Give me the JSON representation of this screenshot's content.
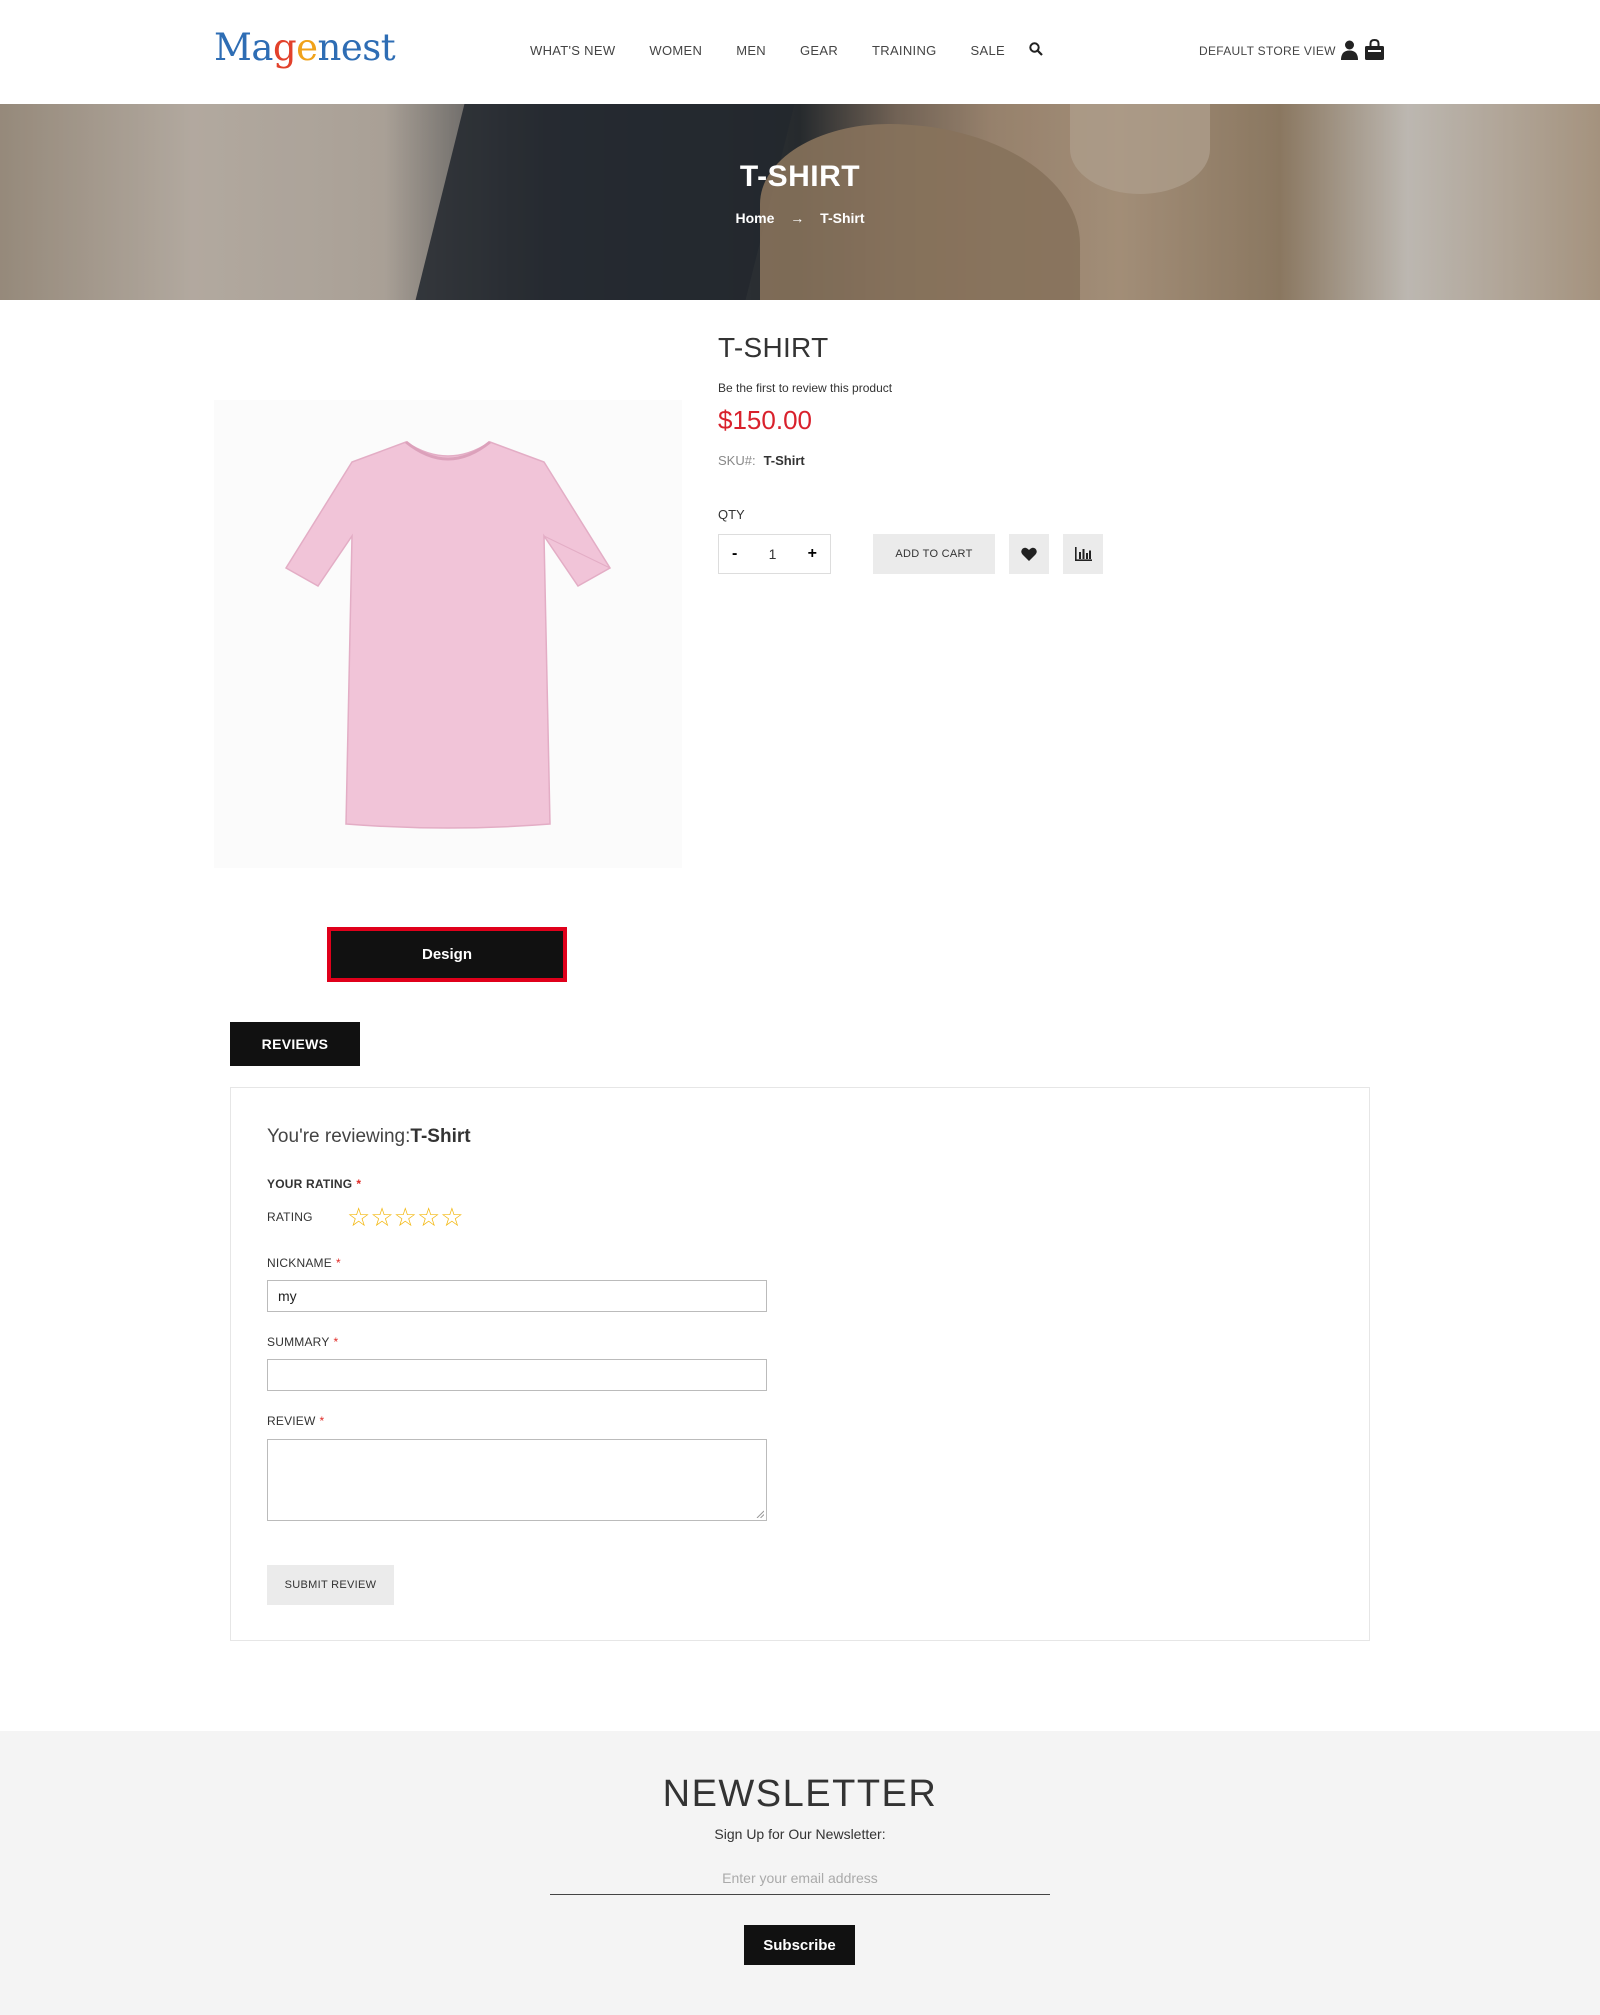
{
  "header": {
    "logo": {
      "p1": "Ma",
      "p2": "g",
      "p3": "e",
      "p4": "nest"
    },
    "nav": [
      "WHAT'S NEW",
      "WOMEN",
      "MEN",
      "GEAR",
      "TRAINING",
      "SALE"
    ],
    "store_view": "DEFAULT STORE VIEW",
    "icons": {
      "search": "search-icon",
      "user": "user-icon",
      "cart": "cart-icon"
    }
  },
  "hero": {
    "title": "T-SHIRT",
    "breadcrumb": {
      "home": "Home",
      "separator": "→",
      "current": "T-Shirt"
    }
  },
  "product": {
    "title": "T-SHIRT",
    "review_link": "Be the first to review this product",
    "price": "$150.00",
    "sku_label": "SKU#:",
    "sku_value": "T-Shirt",
    "qty_label": "QTY",
    "qty_minus": "-",
    "qty_value": "1",
    "qty_plus": "+",
    "add_to_cart": "ADD TO CART",
    "design_button": "Design",
    "image_color": "#f1c4d8"
  },
  "reviews": {
    "tab_label": "REVIEWS",
    "heading_prefix": "You're reviewing:",
    "heading_product": "T-Shirt",
    "your_rating": "YOUR RATING",
    "rating_label": "RATING",
    "stars": [
      "☆",
      "☆",
      "☆",
      "☆",
      "☆"
    ],
    "nickname_label": "NICKNAME",
    "nickname_value": "my",
    "summary_label": "SUMMARY",
    "summary_value": "",
    "review_label": "REVIEW",
    "required_mark": "*",
    "submit": "SUBMIT REVIEW"
  },
  "newsletter": {
    "title": "NEWSLETTER",
    "subtitle": "Sign Up for Our Newsletter:",
    "placeholder": "Enter your email address",
    "button": "Subscribe"
  },
  "colors": {
    "price": "#d9212c",
    "design_border": "#e0001b",
    "star": "#f3b811"
  }
}
